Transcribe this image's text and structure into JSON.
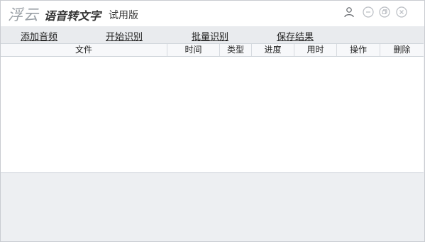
{
  "titlebar": {
    "logo_text": "浮云",
    "app_name": "语音转文字",
    "edition": "试用版",
    "icons": [
      "user-icon",
      "minimize-icon",
      "restore-icon",
      "close-icon"
    ]
  },
  "menu": {
    "items": [
      "添加音频",
      "开始识别",
      "批量识别",
      "保存结果"
    ]
  },
  "table": {
    "columns": [
      "文件",
      "时间",
      "类型",
      "进度",
      "用时",
      "操作",
      "删除"
    ],
    "rows": []
  },
  "colors": {
    "menubar_bg": "#e9ebee",
    "table_header_bg": "#f7f8fa",
    "window_icon": "#b8bcc2"
  }
}
